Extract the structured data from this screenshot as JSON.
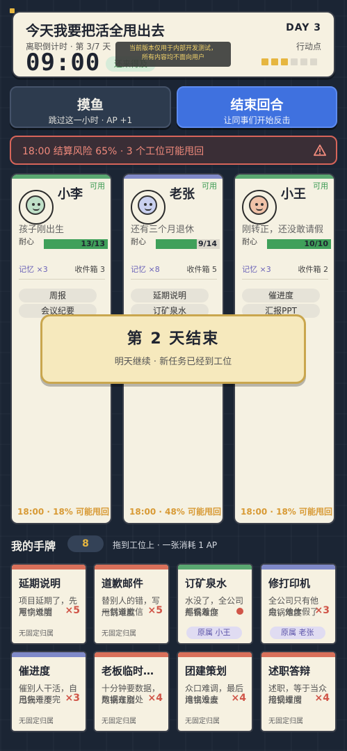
{
  "header": {
    "title": "今天我要把活全甩出去",
    "subtitle": "离职倒计时 · 第 3/7 天",
    "clock": "09:00",
    "pill": "还来得及",
    "day": "DAY 3",
    "ap_label": "行动点",
    "ap_current": 3,
    "ap_max": 6,
    "dev_toast_line1": "当前版本仅用于内部开发测试，",
    "dev_toast_line2": "所有内容均不面向用户"
  },
  "actions": {
    "slack_label": "摸鱼",
    "slack_sub": "跳过这一小时 · AP +1",
    "end_label": "结束回合",
    "end_sub": "让同事们开始反击"
  },
  "risk": {
    "text": "18:00 结算风险 65% · 3 个工位可能甩回"
  },
  "coworkers": [
    {
      "name": "小李",
      "status": "可用",
      "desc": "孩子刚出生",
      "patience_label": "耐心",
      "patience_text": "13/13",
      "patience_frac": 1.0,
      "memory": "记忆 ×3",
      "inbox": "收件箱 3",
      "tasks": [
        "周报",
        "会议纪要"
      ],
      "foot": "18:00 · 18% 可能甩回",
      "band_color": "#5aa871",
      "face_color": "#bfe0c8"
    },
    {
      "name": "老张",
      "status": "可用",
      "desc": "还有三个月退休",
      "patience_label": "耐心",
      "patience_text": "9/14",
      "patience_frac": 0.643,
      "memory": "记忆 ×8",
      "inbox": "收件箱 5",
      "tasks": [
        "延期说明",
        "订矿泉水"
      ],
      "foot": "18:00 · 48% 可能甩回",
      "band_color": "#7f89c8",
      "face_color": "#c9d0ef"
    },
    {
      "name": "小王",
      "status": "可用",
      "desc": "刚转正，还没敢请假",
      "patience_label": "耐心",
      "patience_text": "10/10",
      "patience_frac": 1.0,
      "memory": "记忆 ×3",
      "inbox": "收件箱 2",
      "tasks": [
        "催进度",
        "汇报PPT"
      ],
      "foot": "18:00 · 18% 可能甩回",
      "band_color": "#5aa871",
      "face_color": "#f0c2a8"
    }
  ],
  "modal": {
    "title": "第 2 天结束",
    "subtitle": "明天继续 · 新任务已经到工位"
  },
  "hand": {
    "title": "我的手牌",
    "count": "8",
    "hint": "拖到工位上 · 一张消耗 1 AP"
  },
  "cards": [
    {
      "title": "延期说明",
      "desc": "项目延期了，先写个说明",
      "difficulty": "甩锅难度",
      "mult": "×5",
      "owner": "无固定归属",
      "band": "#d9705a"
    },
    {
      "title": "道歉邮件",
      "desc": "替别人的错，写一封道歉信",
      "difficulty": "甩锅难度",
      "mult": "×5",
      "owner": "无固定归属",
      "band": "#d9705a"
    },
    {
      "title": "订矿泉水",
      "desc": "水没了，全公司都看着你",
      "difficulty": "甩锅难度",
      "mult": "",
      "owner": "原属 小王",
      "band": "#5aa871"
    },
    {
      "title": "修打印机",
      "desc": "全公司只有他会，他休假了",
      "difficulty": "甩锅难度",
      "mult": "×3",
      "owner": "原属 老张",
      "band": "#7f89c8"
    },
    {
      "title": "催进度",
      "desc": "催别人干活，自己先干不完",
      "difficulty": "甩锅难度",
      "mult": "×3",
      "owner": "无固定归属",
      "band": "#7f89c8"
    },
    {
      "title": "老板临时…",
      "desc": "十分钟要数据，数据在别处",
      "difficulty": "甩锅难度",
      "mult": "×4",
      "owner": "无固定归属",
      "band": "#d9705a"
    },
    {
      "title": "团建策划",
      "desc": "众口难调，最后谁也没去",
      "difficulty": "甩锅难度",
      "mult": "×4",
      "owner": "无固定归属",
      "band": "#d9705a"
    },
    {
      "title": "述职答辩",
      "desc": "述职，等于当众接受提问",
      "difficulty": "甩锅难度",
      "mult": "×4",
      "owner": "无固定归属",
      "band": "#d9705a"
    }
  ]
}
